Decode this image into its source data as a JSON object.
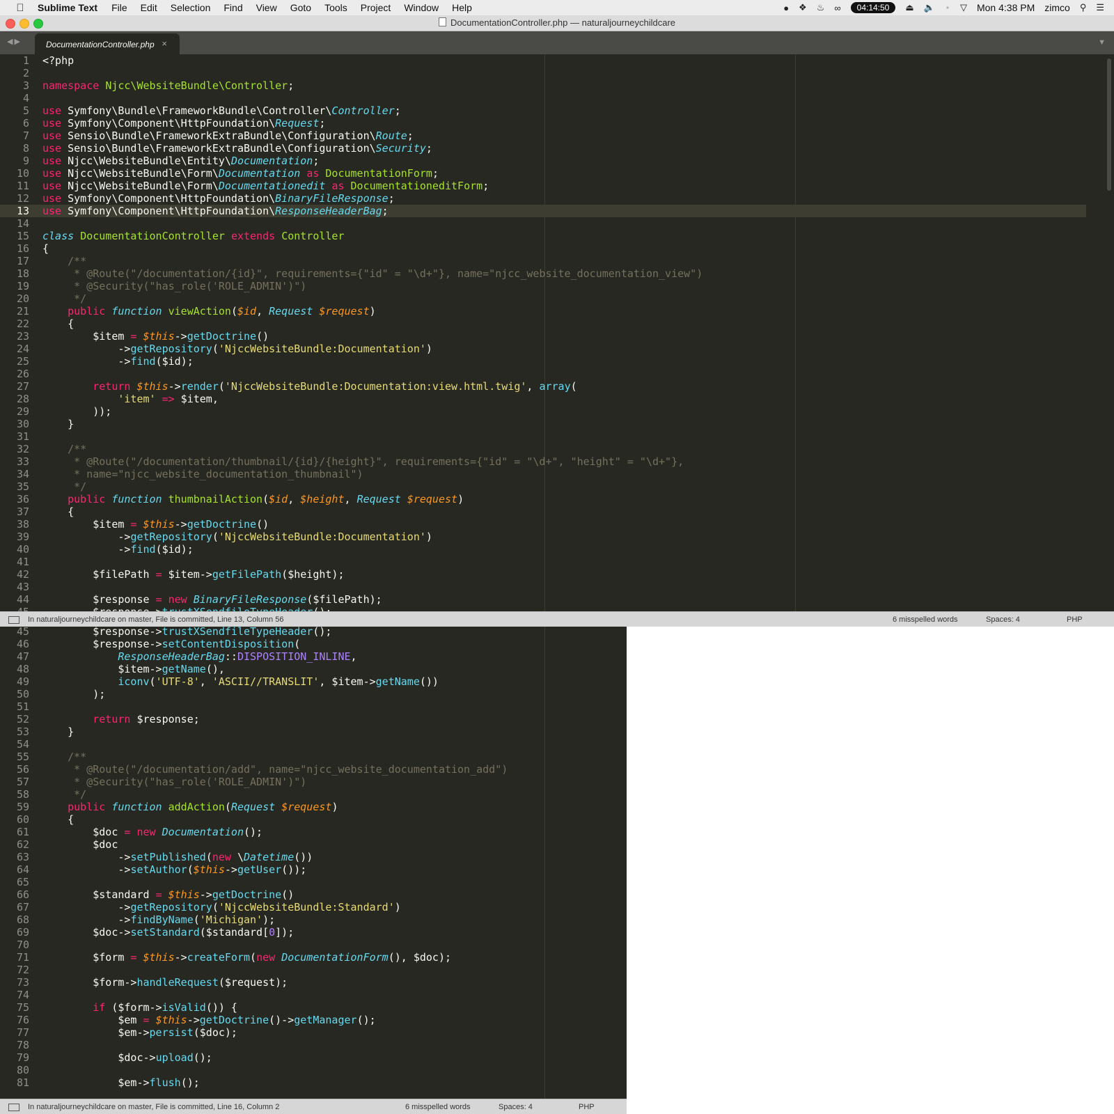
{
  "menubar": {
    "app_name": "Sublime Text",
    "items": [
      "File",
      "Edit",
      "Selection",
      "Find",
      "View",
      "Goto",
      "Tools",
      "Project",
      "Window",
      "Help"
    ],
    "clock": "04:14:50",
    "datetime": "Mon 4:38 PM",
    "user": "zimco"
  },
  "window": {
    "title": "DocumentationController.php — naturaljourneychildcare",
    "tab_label": "DocumentationController.php",
    "tab_close": "×"
  },
  "pane1": {
    "status_left": "In naturaljourneychildcare on master, File is committed, Line 13, Column 56",
    "misspelled": "6 misspelled words",
    "spaces": "Spaces: 4",
    "syntax": "PHP"
  },
  "pane2": {
    "status_left": "In naturaljourneychildcare on master, File is committed, Line 16, Column 2",
    "misspelled": "6 misspelled words",
    "spaces": "Spaces: 4",
    "syntax": "PHP"
  },
  "code_lines": [
    [
      [
        "",
        "<?php"
      ]
    ],
    [],
    [
      [
        "k",
        "namespace"
      ],
      [
        "",
        " "
      ],
      [
        "f",
        "Njcc\\WebsiteBundle\\Controller"
      ],
      [
        "",
        ";"
      ]
    ],
    [],
    [
      [
        "k",
        "use"
      ],
      [
        "",
        " Symfony\\Bundle\\FrameworkBundle\\Controller\\"
      ],
      [
        "y",
        "Controller"
      ],
      [
        "",
        ";"
      ]
    ],
    [
      [
        "k",
        "use"
      ],
      [
        "",
        " Symfony\\Component\\HttpFoundation\\"
      ],
      [
        "y",
        "Request"
      ],
      [
        "",
        ";"
      ]
    ],
    [
      [
        "k",
        "use"
      ],
      [
        "",
        " Sensio\\Bundle\\FrameworkExtraBundle\\Configuration\\"
      ],
      [
        "y",
        "Route"
      ],
      [
        "",
        ";"
      ]
    ],
    [
      [
        "k",
        "use"
      ],
      [
        "",
        " Sensio\\Bundle\\FrameworkExtraBundle\\Configuration\\"
      ],
      [
        "y",
        "Security"
      ],
      [
        "",
        ";"
      ]
    ],
    [
      [
        "k",
        "use"
      ],
      [
        "",
        " Njcc\\WebsiteBundle\\Entity\\"
      ],
      [
        "y",
        "Documentation"
      ],
      [
        "",
        ";"
      ]
    ],
    [
      [
        "k",
        "use"
      ],
      [
        "",
        " Njcc\\WebsiteBundle\\Form\\"
      ],
      [
        "y",
        "Documentation"
      ],
      [
        "",
        " "
      ],
      [
        "k",
        "as"
      ],
      [
        "",
        " "
      ],
      [
        "f",
        "DocumentationForm"
      ],
      [
        "",
        ";"
      ]
    ],
    [
      [
        "k",
        "use"
      ],
      [
        "",
        " Njcc\\WebsiteBundle\\Form\\"
      ],
      [
        "y",
        "Documentationedit"
      ],
      [
        "",
        " "
      ],
      [
        "k",
        "as"
      ],
      [
        "",
        " "
      ],
      [
        "f",
        "DocumentationeditForm"
      ],
      [
        "",
        ";"
      ]
    ],
    [
      [
        "k",
        "use"
      ],
      [
        "",
        " Symfony\\Component\\HttpFoundation\\"
      ],
      [
        "y",
        "BinaryFileResponse"
      ],
      [
        "",
        ";"
      ]
    ],
    [
      [
        "k",
        "use"
      ],
      [
        "",
        " Symfony\\Component\\HttpFoundation\\"
      ],
      [
        "y",
        "ResponseHeaderBag"
      ],
      [
        "",
        ";"
      ]
    ],
    [],
    [
      [
        "y",
        "class"
      ],
      [
        "",
        " "
      ],
      [
        "f",
        "DocumentationController"
      ],
      [
        "",
        " "
      ],
      [
        "k",
        "extends"
      ],
      [
        "",
        " "
      ],
      [
        "f",
        "Controller"
      ]
    ],
    [
      [
        "",
        "{"
      ]
    ],
    [
      [
        "",
        "    "
      ],
      [
        "c",
        "/**"
      ]
    ],
    [
      [
        "c",
        "     * @Route(\"/documentation/{id}\", requirements={\"id\" = \"\\d+\"}, name=\"njcc_website_documentation_view\")"
      ]
    ],
    [
      [
        "c",
        "     * @Security(\"has_role('ROLE_ADMIN')\")"
      ]
    ],
    [
      [
        "c",
        "     */"
      ]
    ],
    [
      [
        "",
        "    "
      ],
      [
        "k",
        "public"
      ],
      [
        "",
        " "
      ],
      [
        "y",
        "function"
      ],
      [
        "",
        " "
      ],
      [
        "f",
        "viewAction"
      ],
      [
        "",
        "("
      ],
      [
        "v",
        "$id"
      ],
      [
        "",
        ", "
      ],
      [
        "y",
        "Request"
      ],
      [
        "",
        " "
      ],
      [
        "v",
        "$request"
      ],
      [
        "",
        ")"
      ]
    ],
    [
      [
        "",
        "    {"
      ]
    ],
    [
      [
        "",
        "        $item "
      ],
      [
        "k",
        "="
      ],
      [
        "",
        " "
      ],
      [
        "v",
        "$this"
      ],
      [
        "",
        "->"
      ],
      [
        "t",
        "getDoctrine"
      ],
      [
        "",
        "()"
      ]
    ],
    [
      [
        "",
        "            ->"
      ],
      [
        "t",
        "getRepository"
      ],
      [
        "",
        "("
      ],
      [
        "s",
        "'NjccWebsiteBundle:Documentation'"
      ],
      [
        "",
        ")"
      ]
    ],
    [
      [
        "",
        "            ->"
      ],
      [
        "t",
        "find"
      ],
      [
        "",
        "($id);"
      ]
    ],
    [],
    [
      [
        "",
        "        "
      ],
      [
        "k",
        "return"
      ],
      [
        "",
        " "
      ],
      [
        "v",
        "$this"
      ],
      [
        "",
        "->"
      ],
      [
        "t",
        "render"
      ],
      [
        "",
        "("
      ],
      [
        "s",
        "'NjccWebsiteBundle:Documentation:view.html.twig'"
      ],
      [
        "",
        ", "
      ],
      [
        "t",
        "array"
      ],
      [
        "",
        "("
      ]
    ],
    [
      [
        "",
        "            "
      ],
      [
        "s",
        "'item'"
      ],
      [
        "",
        " "
      ],
      [
        "k",
        "=>"
      ],
      [
        "",
        " $item,"
      ]
    ],
    [
      [
        "",
        "        ));"
      ]
    ],
    [
      [
        "",
        "    }"
      ]
    ],
    [],
    [
      [
        "",
        "    "
      ],
      [
        "c",
        "/**"
      ]
    ],
    [
      [
        "c",
        "     * @Route(\"/documentation/thumbnail/{id}/{height}\", requirements={\"id\" = \"\\d+\", \"height\" = \"\\d+\"},"
      ]
    ],
    [
      [
        "c",
        "     * name=\"njcc_website_documentation_thumbnail\")"
      ]
    ],
    [
      [
        "c",
        "     */"
      ]
    ],
    [
      [
        "",
        "    "
      ],
      [
        "k",
        "public"
      ],
      [
        "",
        " "
      ],
      [
        "y",
        "function"
      ],
      [
        "",
        " "
      ],
      [
        "f",
        "thumbnailAction"
      ],
      [
        "",
        "("
      ],
      [
        "v",
        "$id"
      ],
      [
        "",
        ", "
      ],
      [
        "v",
        "$height"
      ],
      [
        "",
        ", "
      ],
      [
        "y",
        "Request"
      ],
      [
        "",
        " "
      ],
      [
        "v",
        "$request"
      ],
      [
        "",
        ")"
      ]
    ],
    [
      [
        "",
        "    {"
      ]
    ],
    [
      [
        "",
        "        $item "
      ],
      [
        "k",
        "="
      ],
      [
        "",
        " "
      ],
      [
        "v",
        "$this"
      ],
      [
        "",
        "->"
      ],
      [
        "t",
        "getDoctrine"
      ],
      [
        "",
        "()"
      ]
    ],
    [
      [
        "",
        "            ->"
      ],
      [
        "t",
        "getRepository"
      ],
      [
        "",
        "("
      ],
      [
        "s",
        "'NjccWebsiteBundle:Documentation'"
      ],
      [
        "",
        ")"
      ]
    ],
    [
      [
        "",
        "            ->"
      ],
      [
        "t",
        "find"
      ],
      [
        "",
        "($id);"
      ]
    ],
    [],
    [
      [
        "",
        "        $filePath "
      ],
      [
        "k",
        "="
      ],
      [
        "",
        " $item->"
      ],
      [
        "t",
        "getFilePath"
      ],
      [
        "",
        "($height);"
      ]
    ],
    [],
    [
      [
        "",
        "        $response "
      ],
      [
        "k",
        "="
      ],
      [
        "",
        " "
      ],
      [
        "k",
        "new"
      ],
      [
        "",
        " "
      ],
      [
        "y",
        "BinaryFileResponse"
      ],
      [
        "",
        "($filePath);"
      ]
    ],
    [
      [
        "",
        "        $response->"
      ],
      [
        "t",
        "trustXSendfileTypeHeader"
      ],
      [
        "",
        "();"
      ]
    ],
    [
      [
        "",
        "        $response->"
      ],
      [
        "t",
        "setContentDisposition"
      ],
      [
        "",
        "("
      ]
    ],
    [
      [
        "",
        "            "
      ],
      [
        "y",
        "ResponseHeaderBag"
      ],
      [
        "",
        "::"
      ],
      [
        "n",
        "DISPOSITION_INLINE"
      ],
      [
        "",
        ","
      ]
    ],
    [
      [
        "",
        "            $item->"
      ],
      [
        "t",
        "getName"
      ],
      [
        "",
        "(),"
      ]
    ],
    [
      [
        "",
        "            "
      ],
      [
        "t",
        "iconv"
      ],
      [
        "",
        "("
      ],
      [
        "s",
        "'UTF-8'"
      ],
      [
        "",
        ", "
      ],
      [
        "s",
        "'ASCII//TRANSLIT'"
      ],
      [
        "",
        ", $item->"
      ],
      [
        "t",
        "getName"
      ],
      [
        "",
        "())"
      ]
    ],
    [
      [
        "",
        "        );"
      ]
    ],
    [],
    [
      [
        "",
        "        "
      ],
      [
        "k",
        "return"
      ],
      [
        "",
        " $response;"
      ]
    ],
    [
      [
        "",
        "    }"
      ]
    ],
    [],
    [
      [
        "",
        "    "
      ],
      [
        "c",
        "/**"
      ]
    ],
    [
      [
        "c",
        "     * @Route(\"/documentation/add\", name=\"njcc_website_documentation_add\")"
      ]
    ],
    [
      [
        "c",
        "     * @Security(\"has_role('ROLE_ADMIN')\")"
      ]
    ],
    [
      [
        "c",
        "     */"
      ]
    ],
    [
      [
        "",
        "    "
      ],
      [
        "k",
        "public"
      ],
      [
        "",
        " "
      ],
      [
        "y",
        "function"
      ],
      [
        "",
        " "
      ],
      [
        "f",
        "addAction"
      ],
      [
        "",
        "("
      ],
      [
        "y",
        "Request"
      ],
      [
        "",
        " "
      ],
      [
        "v",
        "$request"
      ],
      [
        "",
        ")"
      ]
    ],
    [
      [
        "",
        "    {"
      ]
    ],
    [
      [
        "",
        "        $doc "
      ],
      [
        "k",
        "="
      ],
      [
        "",
        " "
      ],
      [
        "k",
        "new"
      ],
      [
        "",
        " "
      ],
      [
        "y",
        "Documentation"
      ],
      [
        "",
        "();"
      ]
    ],
    [
      [
        "",
        "        $doc"
      ]
    ],
    [
      [
        "",
        "            ->"
      ],
      [
        "t",
        "setPublished"
      ],
      [
        "",
        "("
      ],
      [
        "k",
        "new"
      ],
      [
        "",
        " \\"
      ],
      [
        "y",
        "Datetime"
      ],
      [
        "",
        "())"
      ]
    ],
    [
      [
        "",
        "            ->"
      ],
      [
        "t",
        "setAuthor"
      ],
      [
        "",
        "("
      ],
      [
        "v",
        "$this"
      ],
      [
        "",
        "->"
      ],
      [
        "t",
        "getUser"
      ],
      [
        "",
        "());"
      ]
    ],
    [],
    [
      [
        "",
        "        $standard "
      ],
      [
        "k",
        "="
      ],
      [
        "",
        " "
      ],
      [
        "v",
        "$this"
      ],
      [
        "",
        "->"
      ],
      [
        "t",
        "getDoctrine"
      ],
      [
        "",
        "()"
      ]
    ],
    [
      [
        "",
        "            ->"
      ],
      [
        "t",
        "getRepository"
      ],
      [
        "",
        "("
      ],
      [
        "s",
        "'NjccWebsiteBundle:Standard'"
      ],
      [
        "",
        ")"
      ]
    ],
    [
      [
        "",
        "            ->"
      ],
      [
        "t",
        "findByName"
      ],
      [
        "",
        "("
      ],
      [
        "s",
        "'Michigan'"
      ],
      [
        "",
        ");"
      ]
    ],
    [
      [
        "",
        "        $doc->"
      ],
      [
        "t",
        "setStandard"
      ],
      [
        "",
        "($standard["
      ],
      [
        "n",
        "0"
      ],
      [
        "",
        "]);"
      ]
    ],
    [],
    [
      [
        "",
        "        $form "
      ],
      [
        "k",
        "="
      ],
      [
        "",
        " "
      ],
      [
        "v",
        "$this"
      ],
      [
        "",
        "->"
      ],
      [
        "t",
        "createForm"
      ],
      [
        "",
        "("
      ],
      [
        "k",
        "new"
      ],
      [
        "",
        " "
      ],
      [
        "y",
        "DocumentationForm"
      ],
      [
        "",
        "(), $doc);"
      ]
    ],
    [],
    [
      [
        "",
        "        $form->"
      ],
      [
        "t",
        "handleRequest"
      ],
      [
        "",
        "($request);"
      ]
    ],
    [],
    [
      [
        "",
        "        "
      ],
      [
        "k",
        "if"
      ],
      [
        "",
        " ($form->"
      ],
      [
        "t",
        "isValid"
      ],
      [
        "",
        "()) {"
      ]
    ],
    [
      [
        "",
        "            $em "
      ],
      [
        "k",
        "="
      ],
      [
        "",
        " "
      ],
      [
        "v",
        "$this"
      ],
      [
        "",
        "->"
      ],
      [
        "t",
        "getDoctrine"
      ],
      [
        "",
        "()->"
      ],
      [
        "t",
        "getManager"
      ],
      [
        "",
        "();"
      ]
    ],
    [
      [
        "",
        "            $em->"
      ],
      [
        "t",
        "persist"
      ],
      [
        "",
        "($doc);"
      ]
    ],
    [],
    [
      [
        "",
        "            $doc->"
      ],
      [
        "t",
        "upload"
      ],
      [
        "",
        "();"
      ]
    ],
    [],
    [
      [
        "",
        "            $em->"
      ],
      [
        "t",
        "flush"
      ],
      [
        "",
        "();"
      ]
    ]
  ]
}
